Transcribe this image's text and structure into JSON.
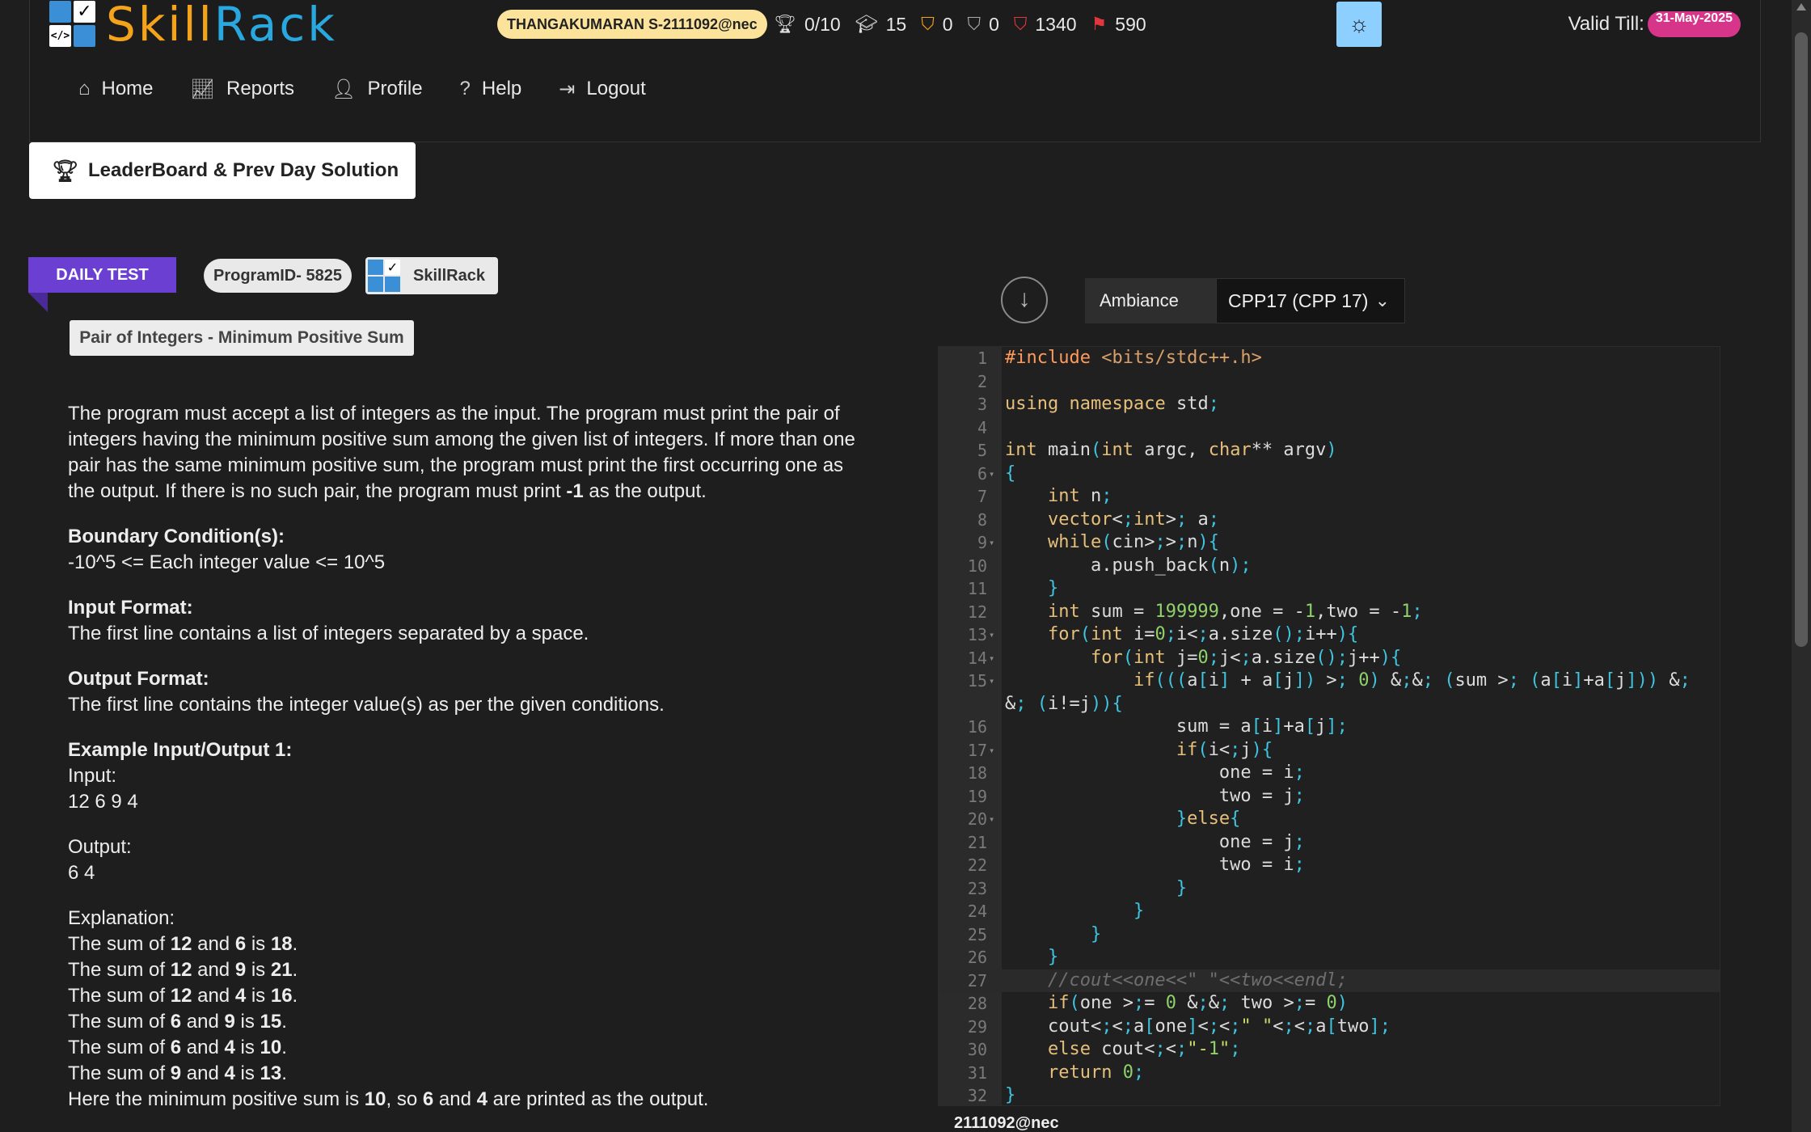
{
  "header": {
    "logo_skill": "Skill",
    "logo_rack": "Rack",
    "user_pill": "THANGAKUMARAN S-2111092@nec",
    "stats": {
      "solved": "0/10",
      "courses": "15",
      "gold": "0",
      "silver": "0",
      "points": "1340",
      "flags": "590"
    },
    "valid_label": "Valid Till:",
    "valid_date": "31-May-2025"
  },
  "nav": {
    "items": [
      {
        "label": "Home",
        "icon": "home-icon"
      },
      {
        "label": "Reports",
        "icon": "chart-icon"
      },
      {
        "label": "Profile",
        "icon": "user-icon"
      },
      {
        "label": "Help",
        "icon": "question-icon"
      },
      {
        "label": "Logout",
        "icon": "logout-icon"
      }
    ]
  },
  "leaderboard_button": "LeaderBoard & Prev Day Solution",
  "problem": {
    "badge": "DAILY TEST",
    "program_id": "ProgramID- 5825",
    "brand": "SkillRack",
    "title": "Pair of Integers - Minimum Positive Sum",
    "intro_1": "The program must accept a list of integers as the input. The program must print the pair of integers having the minimum positive sum among the given list of integers. If more than one pair has the same minimum positive sum, the program must print the first occurring one as the output. If there is no such pair, the program must print ",
    "intro_bold": "-1",
    "intro_2": " as the output.",
    "boundary_heading": "Boundary Condition(s):",
    "boundary_text": "-10^5 <= Each integer value <= 10^5",
    "input_heading": "Input Format:",
    "input_text": "The first line contains a list of integers separated by a space.",
    "output_heading": "Output Format:",
    "output_text": "The first line contains the integer value(s) as per the given conditions.",
    "example_heading": "Example Input/Output 1:",
    "input_label": "Input:",
    "input_value": "12 6 9 4",
    "output_label": "Output:",
    "output_value": "6 4",
    "explanation_label": "Explanation:",
    "sums": [
      {
        "a": "12",
        "b": "6",
        "s": "18"
      },
      {
        "a": "12",
        "b": "9",
        "s": "21"
      },
      {
        "a": "12",
        "b": "4",
        "s": "16"
      },
      {
        "a": "6",
        "b": "9",
        "s": "15"
      },
      {
        "a": "6",
        "b": "4",
        "s": "10"
      },
      {
        "a": "9",
        "b": "4",
        "s": "13"
      }
    ],
    "sum_prefix": "The sum of ",
    "sum_and": " and ",
    "sum_is": " is ",
    "sum_end": ".",
    "conclusion_1": "Here the minimum positive sum is ",
    "conclusion_min": "10",
    "conclusion_2": ", so ",
    "conclusion_a": "6",
    "conclusion_3": " and ",
    "conclusion_b": "4",
    "conclusion_4": " are printed as the output."
  },
  "editor": {
    "theme": "Ambiance",
    "language": "CPP17 (CPP 17)",
    "footer_user": "2111092@nec",
    "lines": [
      "#include <bits/stdc++.h>",
      "",
      "using namespace std;",
      "",
      "int main(int argc, char** argv)",
      "{",
      "    int n;",
      "    vector<int> a;",
      "    while(cin>>n){",
      "        a.push_back(n);",
      "    }",
      "    int sum = 199999,one = -1,two = -1;",
      "    for(int i=0;i<a.size();i++){",
      "        for(int j=0;j<a.size();j++){",
      "            if(((a[i] + a[j]) > 0) && (sum > (a[i]+a[j])) && (i!=j)){",
      "                sum = a[i]+a[j];",
      "                if(i<j){",
      "                    one = i;",
      "                    two = j;",
      "                }else{",
      "                    one = j;",
      "                    two = i;",
      "                }",
      "            }",
      "        }",
      "    }",
      "    //cout<<one<<\" \"<<two<<endl;",
      "    if(one >= 0 && two >= 0)",
      "    cout<<a[one]<<\" \"<<a[two];",
      "    else cout<<\"-1\";",
      "    return 0;",
      "}"
    ]
  },
  "colors": {
    "accent_purple": "#6b3fd1",
    "user_pill": "#fbe39b",
    "date_pill": "#d7358a",
    "theme_button": "#8dd0ff",
    "logo_orange": "#f4a31b",
    "logo_blue": "#29a8e0"
  }
}
